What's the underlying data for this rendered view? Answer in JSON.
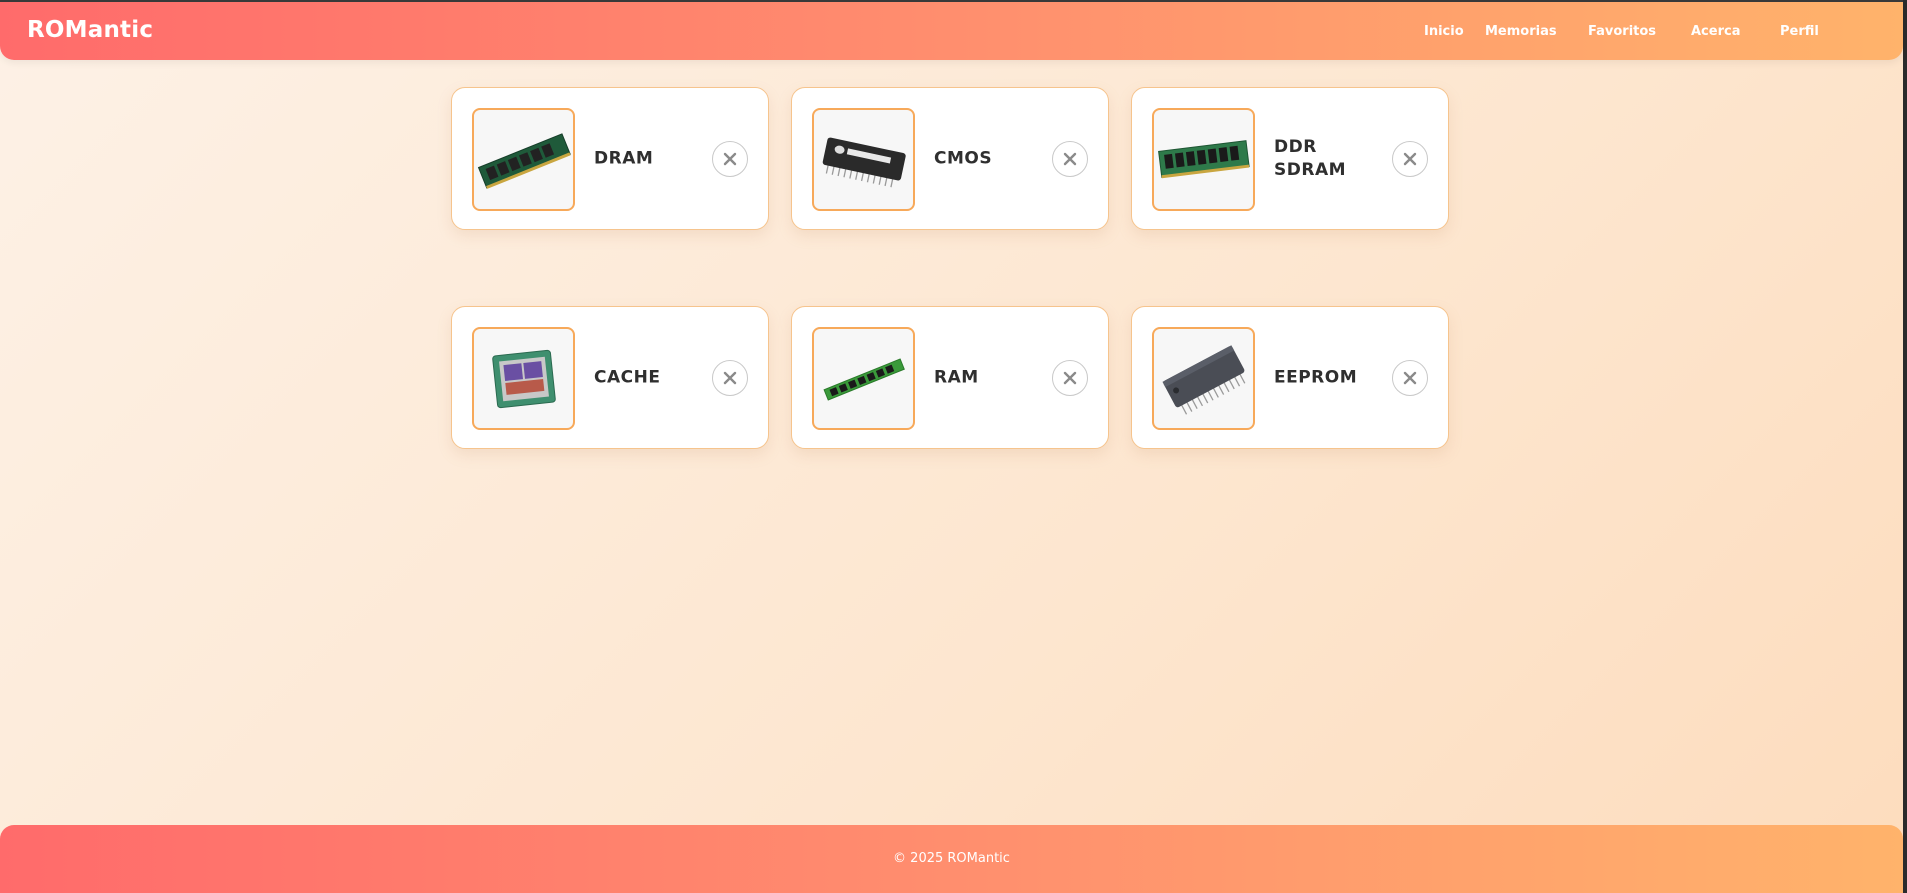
{
  "header": {
    "brand": "ROMantic",
    "nav": [
      "Inicio",
      "Memorias",
      "Favoritos",
      "Acerca",
      "Perfil"
    ]
  },
  "favorites": [
    {
      "name": "DRAM",
      "image": "dram-module-image"
    },
    {
      "name": "CMOS",
      "image": "cmos-chip-image"
    },
    {
      "name": "DDR SDRAM",
      "image": "ddr-sdram-module-image"
    },
    {
      "name": "CACHE",
      "image": "cache-processor-image"
    },
    {
      "name": "RAM",
      "image": "ram-stick-image"
    },
    {
      "name": "EEPROM",
      "image": "eeprom-chip-image"
    }
  ],
  "footer": {
    "copyright": "© 2025 ROMantic"
  },
  "colors": {
    "accent_start": "#ff6b6b",
    "accent_end": "#ffb36b",
    "card_border": "#f6c48d",
    "thumb_border": "#f7a95a"
  }
}
